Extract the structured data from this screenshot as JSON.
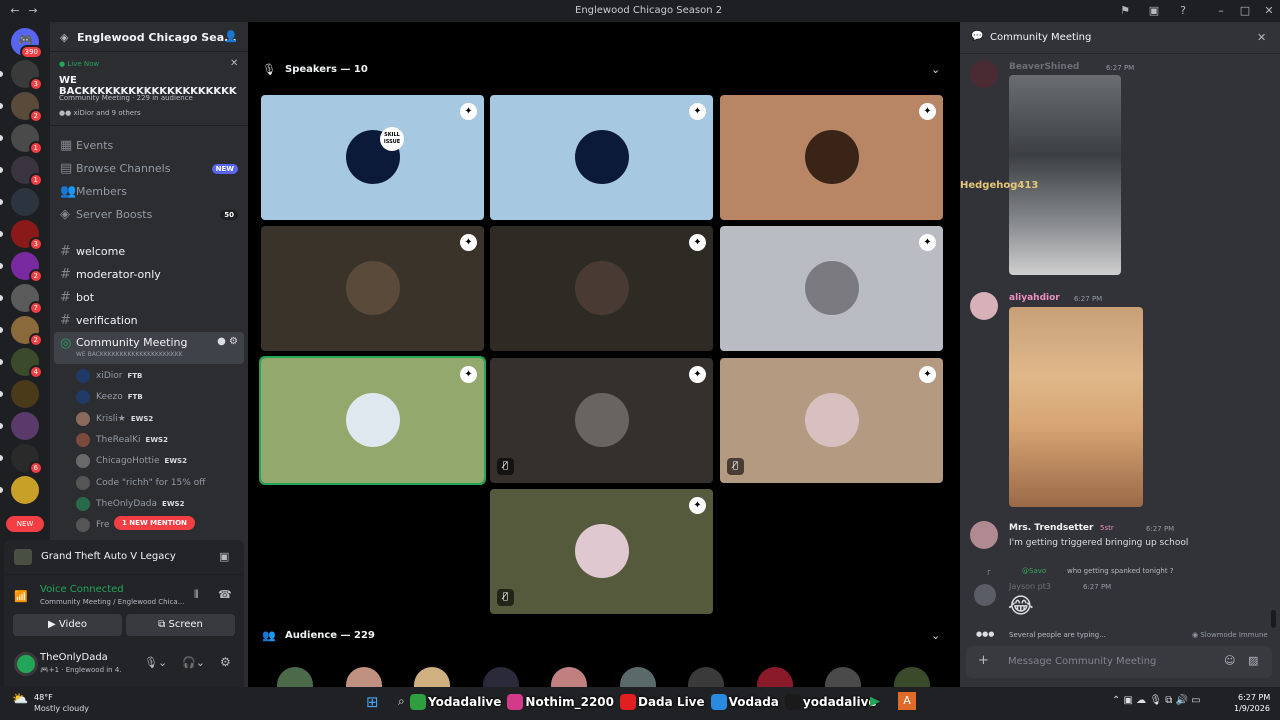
{
  "window": {
    "title": "Englewood Chicago Season 2"
  },
  "servers": {
    "dm_badge": "390",
    "badges": [
      "3",
      "2",
      "1",
      "1",
      "",
      "3",
      "2",
      "7",
      "2",
      "4",
      "",
      "",
      "6",
      ""
    ],
    "new_label": "NEW"
  },
  "guild": {
    "name": "Englewood Chicago Sea...",
    "live": {
      "label": "Live Now",
      "title": "WE BACKKKKKKKKKKKKKKKKKKKK",
      "meta": "Community Meeting · 229 in audience",
      "others": "xiDior and 9 others"
    },
    "nav": [
      {
        "label": "Events"
      },
      {
        "label": "Browse Channels",
        "badge": "NEW"
      },
      {
        "label": "Members"
      },
      {
        "label": "Server Boosts",
        "badge": "50"
      }
    ],
    "channels": [
      "welcome",
      "moderator-only",
      "bot",
      "verification"
    ],
    "stage": {
      "name": "Community Meeting",
      "topic": "WE BACKKKKKKKKKKKKKKKKKKKKK"
    },
    "voice_users": [
      {
        "name": "xiDior",
        "tag": "FTB"
      },
      {
        "name": "Keezo",
        "tag": "FTB"
      },
      {
        "name": "Krisli★",
        "tag": "EWS2"
      },
      {
        "name": "TheRealKi",
        "tag": "EWS2"
      },
      {
        "name": "ChicagoHottie",
        "tag": "EWS2"
      },
      {
        "name": "Code \"richh\" for 15% off",
        "tag": ""
      },
      {
        "name": "TheOnlyDada",
        "tag": "EWS2"
      },
      {
        "name": "Fre",
        "tag": ""
      }
    ],
    "mention_pill": "1 NEW MENTION"
  },
  "activity": {
    "game": "Grand Theft Auto V Legacy"
  },
  "voice": {
    "status": "Voice Connected",
    "location": "Community Meeting / Englewood Chica...",
    "video_label": "Video",
    "screen_label": "Screen"
  },
  "user": {
    "name": "TheOnlyDada",
    "status": "Englewood in 4."
  },
  "stage_view": {
    "speakers_label": "Speakers — 10",
    "audience_label": "Audience — 229",
    "skill_issue": "SKILL ISSUE",
    "tiles": [
      {
        "bg": "#a6c8e0",
        "muted": false,
        "selected": false
      },
      {
        "bg": "#a6c8e0",
        "muted": false,
        "selected": false
      },
      {
        "bg": "#b88664",
        "muted": false,
        "selected": false
      },
      {
        "bg": "#3a332a",
        "muted": false,
        "selected": false
      },
      {
        "bg": "#2e2a24",
        "muted": false,
        "selected": false
      },
      {
        "bg": "#b9bcc2",
        "muted": false,
        "selected": false
      },
      {
        "bg": "#93a86c",
        "muted": false,
        "selected": true
      },
      {
        "bg": "#35302c",
        "muted": true,
        "selected": false
      },
      {
        "bg": "#b49a80",
        "muted": true,
        "selected": false
      },
      {
        "bg": "#555a3c",
        "muted": true,
        "selected": false
      }
    ]
  },
  "chat": {
    "title": "Community Meeting",
    "messages": [
      {
        "author": "BeaverShined",
        "time": "6:27 PM"
      },
      {
        "author": "Hedgehog413",
        "time": ""
      },
      {
        "author": "aliyahdior",
        "time": "6:27 PM"
      },
      {
        "author": "Mrs. Trendsetter",
        "tag": "5str",
        "time": "6:27 PM",
        "text": "I'm getting triggered bringing up school"
      },
      {
        "reply_to": "@Savo",
        "reply_text": "who getting spanked tonight ?",
        "author": "Jayson pt3",
        "time": "6:27 PM",
        "text": "😂"
      }
    ],
    "typing": "Several people are typing...",
    "slowmode": "Slowmode Immune",
    "input_placeholder": "Message Community Meeting"
  },
  "taskbar": {
    "weather_temp": "48°F",
    "weather_desc": "Mostly cloudy",
    "time": "6:27 PM",
    "date": "1/9/2026",
    "overlay": [
      "Yodadalive",
      "Nothim_2200",
      "Dada Live",
      "Vodada",
      "yodadalive"
    ]
  }
}
